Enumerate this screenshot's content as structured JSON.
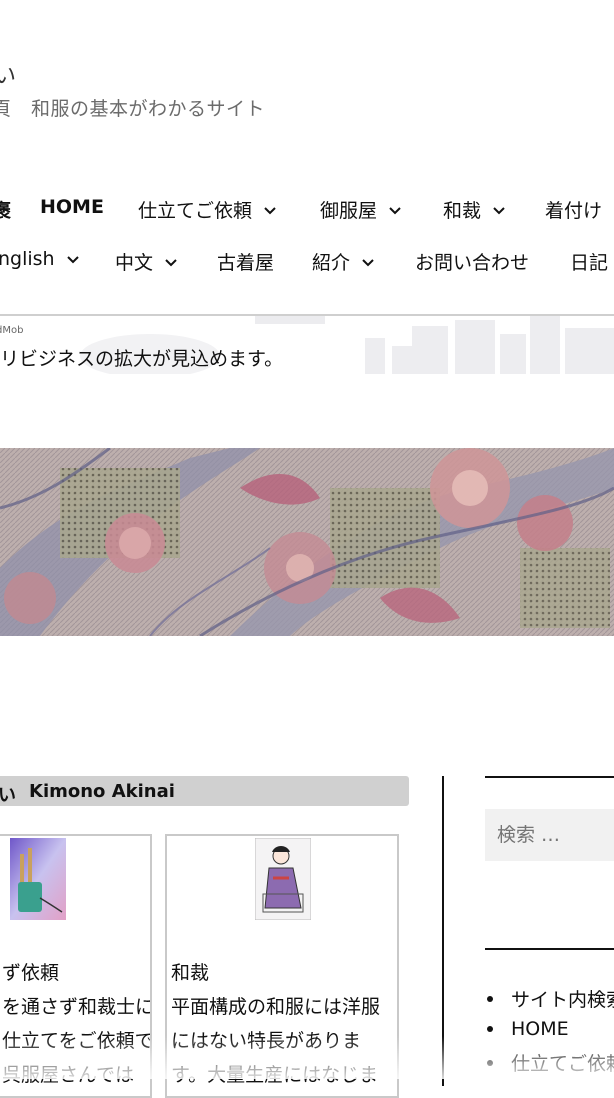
{
  "site": {
    "title_fragment": "い",
    "description": "頁　和服の基本がわかるサイト"
  },
  "nav": {
    "row1": [
      {
        "label": "褒",
        "dropdown": false,
        "bold": true
      },
      {
        "label": "HOME",
        "dropdown": false,
        "bold": true
      },
      {
        "label": "仕立てご依頼",
        "dropdown": true,
        "bold": false
      },
      {
        "label": "御服屋",
        "dropdown": true,
        "bold": false
      },
      {
        "label": "和裁",
        "dropdown": true,
        "bold": false
      },
      {
        "label": "着付け",
        "dropdown": false,
        "bold": false
      }
    ],
    "row2": [
      {
        "label": "nglish",
        "dropdown": true
      },
      {
        "label": "中文",
        "dropdown": true
      },
      {
        "label": "古着屋",
        "dropdown": false
      },
      {
        "label": "紹介",
        "dropdown": true
      },
      {
        "label": "お問い合わせ",
        "dropdown": false
      },
      {
        "label": "日記",
        "dropdown": false
      }
    ]
  },
  "ad": {
    "label": "dMob",
    "text": "リビジネスの拡大が見込めます。",
    "subtext": "・・・・・・・・・・・・・・・・・"
  },
  "section": {
    "title_prefix": "い",
    "title": "Kimono Akinai"
  },
  "cards": [
    {
      "title": "ず依頼",
      "lines": [
        "を通さず和裁士に",
        "仕立てをご依頼で",
        "呉服屋さんでは"
      ],
      "image_icon": "brush-pot-icon"
    },
    {
      "title": "和裁",
      "lines": [
        "平面構成の和服には洋服",
        "にはない特長がありま",
        "す。大量生産にはなじま"
      ],
      "image_icon": "seamstress-illustration-icon"
    }
  ],
  "sidebar": {
    "search_placeholder": "検索 …",
    "links": [
      "サイト内検索",
      "HOME",
      "仕立てご依頼"
    ]
  },
  "colors": {
    "section_bar": "#d0d0d0",
    "divider": "#111111",
    "search_bg": "#f1f1f1"
  }
}
